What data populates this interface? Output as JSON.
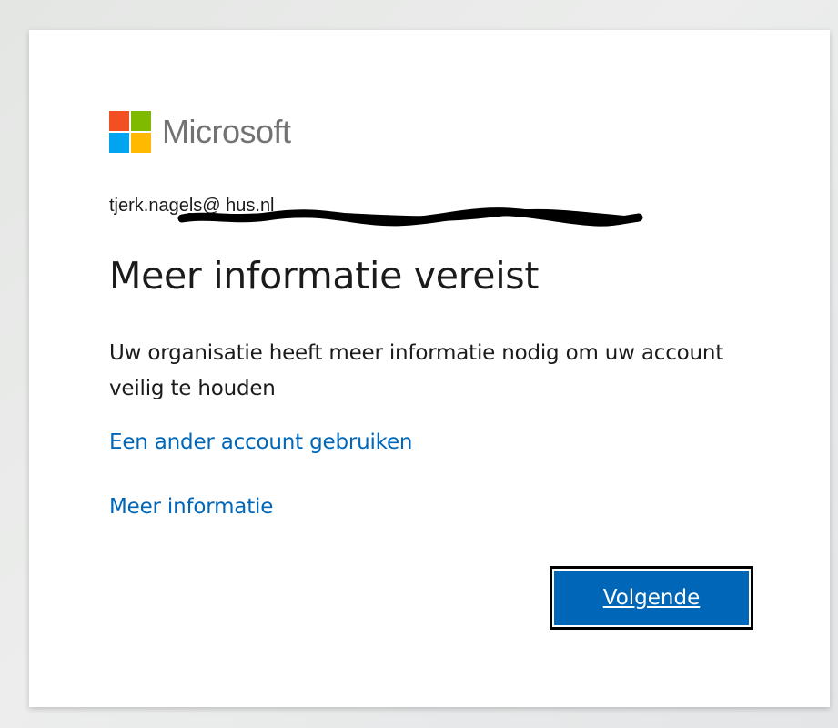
{
  "logo": {
    "text": "Microsoft",
    "colors": [
      "#f25022",
      "#7fba00",
      "#00a4ef",
      "#ffb900"
    ]
  },
  "identity": {
    "email_visible": "tjerk.nagels@                                       hus.nl",
    "redacted": true
  },
  "title": "Meer informatie vereist",
  "description": "Uw organisatie heeft meer informatie nodig om uw account veilig te houden",
  "links": {
    "other_account": "Een ander account gebruiken",
    "more_info": "Meer informatie"
  },
  "buttons": {
    "next": "Volgende"
  },
  "colors": {
    "accent": "#0067b8",
    "text": "#1b1b1b"
  }
}
